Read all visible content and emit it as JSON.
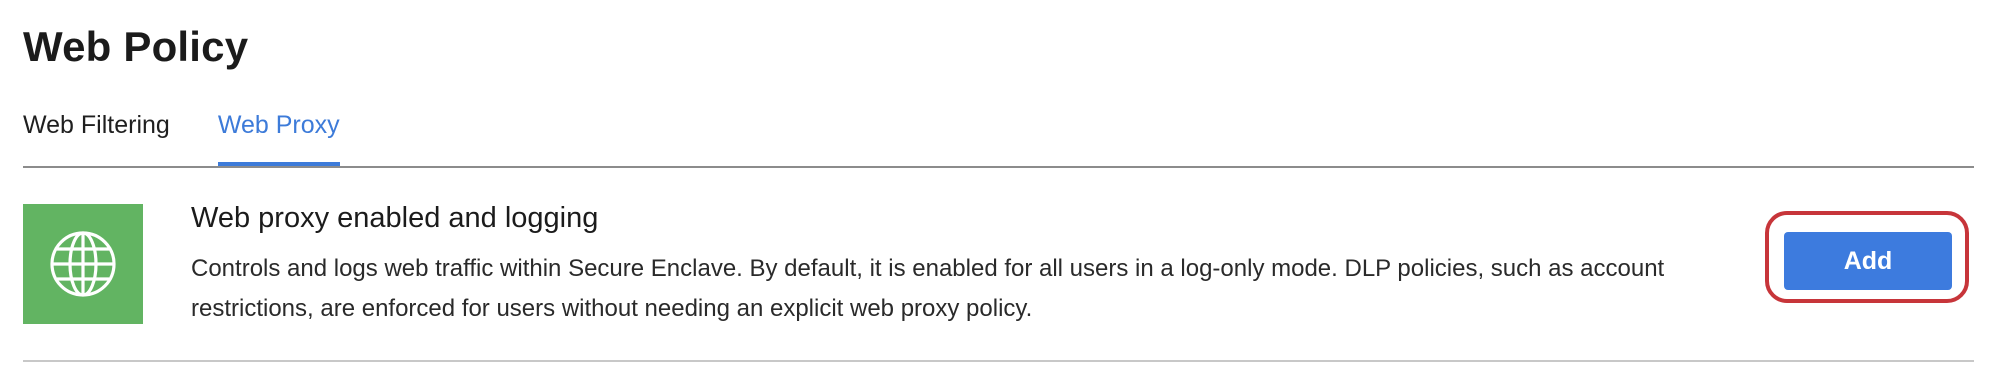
{
  "header": {
    "title": "Web Policy"
  },
  "tabs": [
    {
      "label": "Web Filtering",
      "active": false
    },
    {
      "label": "Web Proxy",
      "active": true
    }
  ],
  "policy": {
    "icon": "globe-icon",
    "title": "Web proxy enabled and logging",
    "description": "Controls and logs web traffic within Secure Enclave. By default, it is enabled for all users in a log-only mode. DLP policies, such as account restrictions, are enforced for users without needing an explicit web proxy policy.",
    "add_label": "Add"
  },
  "colors": {
    "accent": "#3d7bd9",
    "icon_bg": "#62b462",
    "highlight": "#c7353a"
  }
}
